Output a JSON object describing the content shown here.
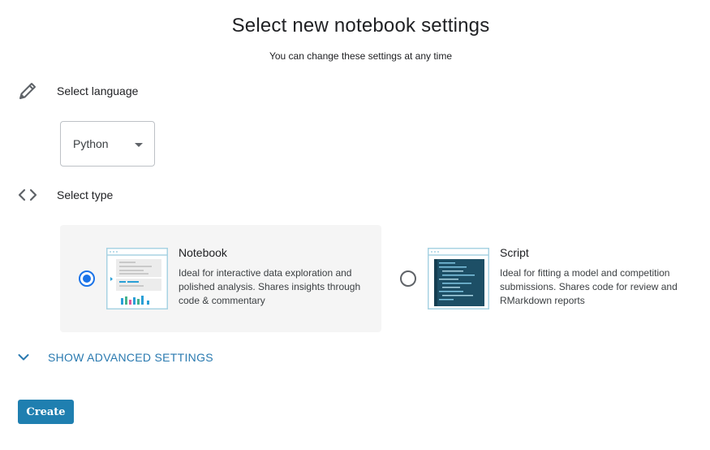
{
  "header": {
    "title": "Select new notebook settings",
    "subtitle": "You can change these settings at any time"
  },
  "language": {
    "label": "Select language",
    "icon": "pencil-icon",
    "selected": "Python"
  },
  "type": {
    "label": "Select type",
    "icon": "code-brackets-icon",
    "options": [
      {
        "title": "Notebook",
        "description": "Ideal for interactive data exploration and polished analysis. Shares insights through code & commentary",
        "selected": true
      },
      {
        "title": "Script",
        "description": "Ideal for fitting a model and competition submissions. Shares code for review and RMarkdown reports",
        "selected": false
      }
    ]
  },
  "advanced": {
    "label": "SHOW ADVANCED SETTINGS",
    "icon": "chevron-down-icon"
  },
  "actions": {
    "create_label": "Create"
  },
  "colors": {
    "accent": "#1a73e8",
    "link": "#2a7ab0",
    "button": "#1f7fb0",
    "thumb_border": "#a8d3e3",
    "script_bg": "#1d4f66"
  }
}
